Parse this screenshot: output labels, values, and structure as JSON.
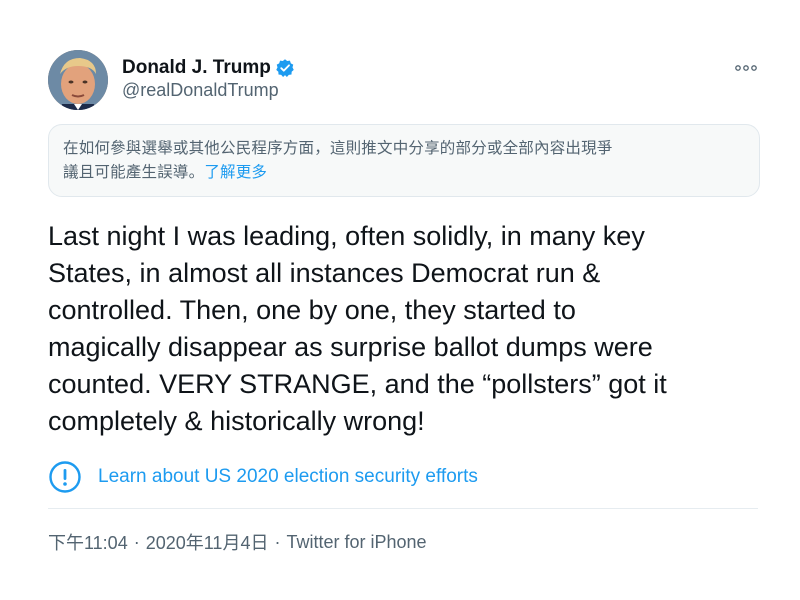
{
  "author": {
    "name": "Donald J. Trump",
    "handle": "@realDonaldTrump",
    "verified": true
  },
  "more_icon": "more-dots-icon",
  "notice": {
    "text": "在如何參與選舉或其他公民程序方面，這則推文中分享的部分或全部內容出現爭議且可能產生誤導。",
    "line1": "在如何參與選舉或其他公民程序方面，這則推文中分享的部分或全部內容出現爭",
    "line2": "議且可能產生誤導。",
    "link_label": "了解更多"
  },
  "tweet": {
    "lines": [
      "Last night I was leading, often solidly, in many key",
      "States, in almost all instances Democrat run &",
      "controlled. Then, one by one, they started to",
      "magically disappear as surprise ballot dumps were",
      "counted. VERY STRANGE, and the “pollsters” got it",
      "completely & historically wrong!"
    ]
  },
  "election_link": {
    "icon": "exclamation-circle-icon",
    "label": "Learn about US 2020 election security efforts"
  },
  "meta": {
    "time": "下午11:04",
    "separator": "·",
    "date": "2020年11月4日",
    "source": "Twitter for iPhone"
  },
  "colors": {
    "accent": "#1d9bf0",
    "text": "#0f1419",
    "secondary": "#536471",
    "notice_bg": "#f7f9f9"
  }
}
